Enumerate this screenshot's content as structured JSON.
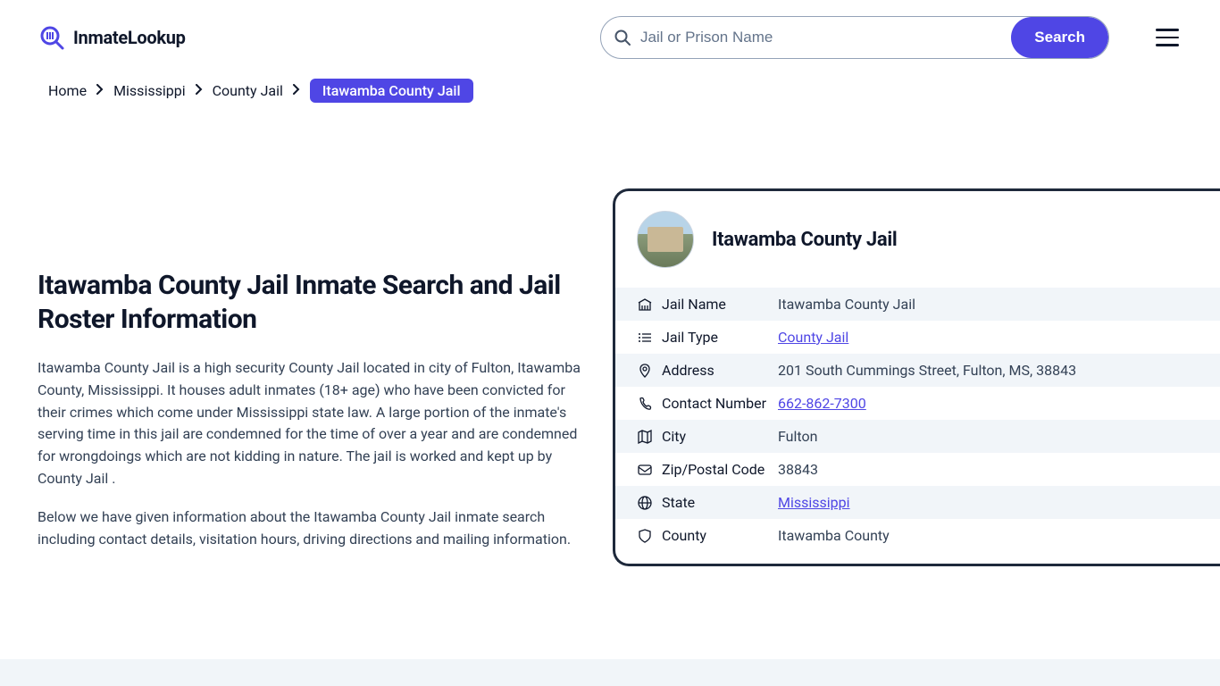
{
  "logo": {
    "text": "InmateLookup"
  },
  "search": {
    "placeholder": "Jail or Prison Name",
    "button": "Search"
  },
  "breadcrumb": {
    "items": [
      {
        "label": "Home",
        "current": false
      },
      {
        "label": "Mississippi",
        "current": false
      },
      {
        "label": "County Jail",
        "current": false
      },
      {
        "label": "Itawamba County Jail",
        "current": true
      }
    ]
  },
  "page": {
    "title": "Itawamba County Jail Inmate Search and Jail Roster Information",
    "desc1": "Itawamba County Jail is a high security County Jail located in city of Fulton, Itawamba County, Mississippi. It houses adult inmates (18+ age) who have been convicted for their crimes which come under Mississippi state law. A large portion of the inmate's serving time in this jail are condemned for the time of over a year and are condemned for wrongdoings which are not kidding in nature. The jail is worked and kept up by County Jail .",
    "desc2": "Below we have given information about the Itawamba County Jail inmate search including contact details, visitation hours, driving directions and mailing information."
  },
  "card": {
    "title": "Itawamba County Jail",
    "rows": [
      {
        "icon": "building-icon",
        "label": "Jail Name",
        "value": "Itawamba County Jail",
        "link": false,
        "alt": true
      },
      {
        "icon": "list-icon",
        "label": "Jail Type",
        "value": "County Jail",
        "link": true,
        "alt": false
      },
      {
        "icon": "pin-icon",
        "label": "Address",
        "value": "201 South Cummings Street, Fulton, MS, 38843",
        "link": false,
        "alt": true
      },
      {
        "icon": "phone-icon",
        "label": "Contact Number",
        "value": "662-862-7300",
        "link": true,
        "alt": false
      },
      {
        "icon": "map-icon",
        "label": "City",
        "value": "Fulton",
        "link": false,
        "alt": true
      },
      {
        "icon": "mail-icon",
        "label": "Zip/Postal Code",
        "value": "38843",
        "link": false,
        "alt": false
      },
      {
        "icon": "globe-icon",
        "label": "State",
        "value": "Mississippi",
        "link": true,
        "alt": true
      },
      {
        "icon": "shield-icon",
        "label": "County",
        "value": "Itawamba County",
        "link": false,
        "alt": false
      }
    ]
  }
}
